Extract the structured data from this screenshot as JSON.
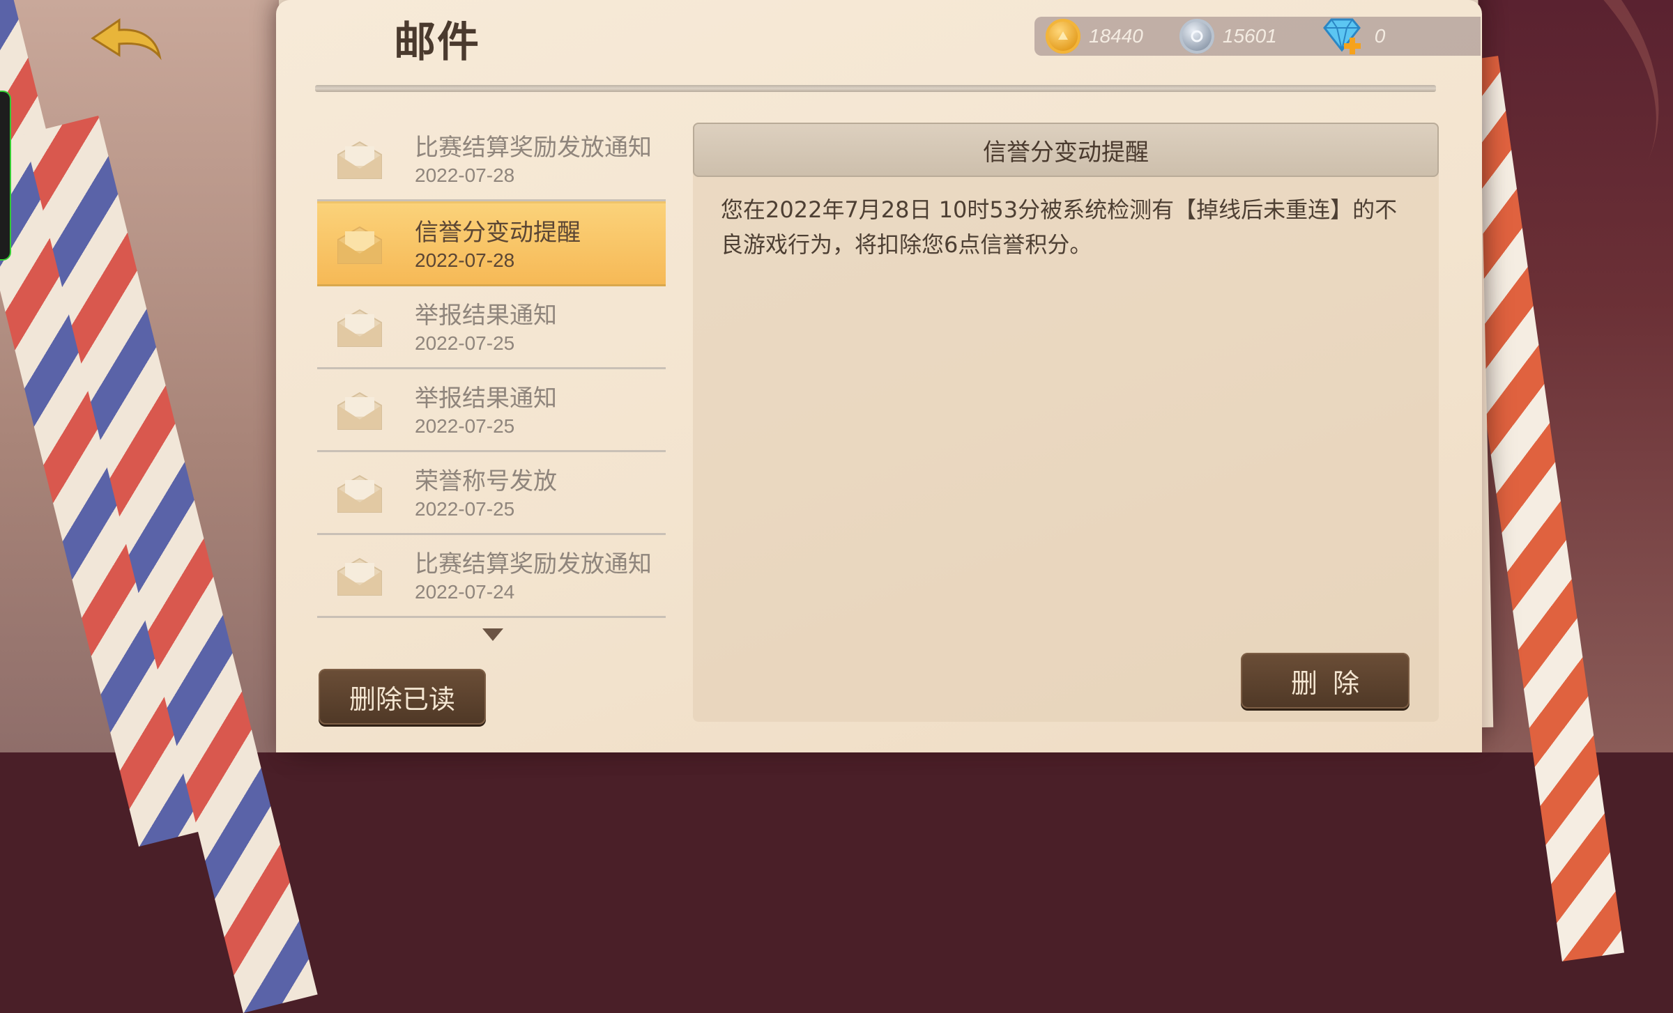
{
  "header": {
    "title": "邮件"
  },
  "currency": {
    "gold": "18440",
    "silver": "15601",
    "gems": "0"
  },
  "mails": [
    {
      "title": "比赛结算奖励发放通知",
      "date": "2022-07-28",
      "selected": false
    },
    {
      "title": "信誉分变动提醒",
      "date": "2022-07-28",
      "selected": true
    },
    {
      "title": "举报结果通知",
      "date": "2022-07-25",
      "selected": false
    },
    {
      "title": "举报结果通知",
      "date": "2022-07-25",
      "selected": false
    },
    {
      "title": "荣誉称号发放",
      "date": "2022-07-25",
      "selected": false
    },
    {
      "title": "比赛结算奖励发放通知",
      "date": "2022-07-24",
      "selected": false
    }
  ],
  "detail": {
    "title": "信誉分变动提醒",
    "body": "您在2022年7月28日 10时53分被系统检测有【掉线后未重连】的不良游戏行为，将扣除您6点信誉积分。"
  },
  "buttons": {
    "delete_read": "删除已读",
    "delete": "删除"
  },
  "colors": {
    "selected_bg": "#f6b956",
    "button_bg": "#4f3826",
    "paper": "#f3e4cf"
  }
}
